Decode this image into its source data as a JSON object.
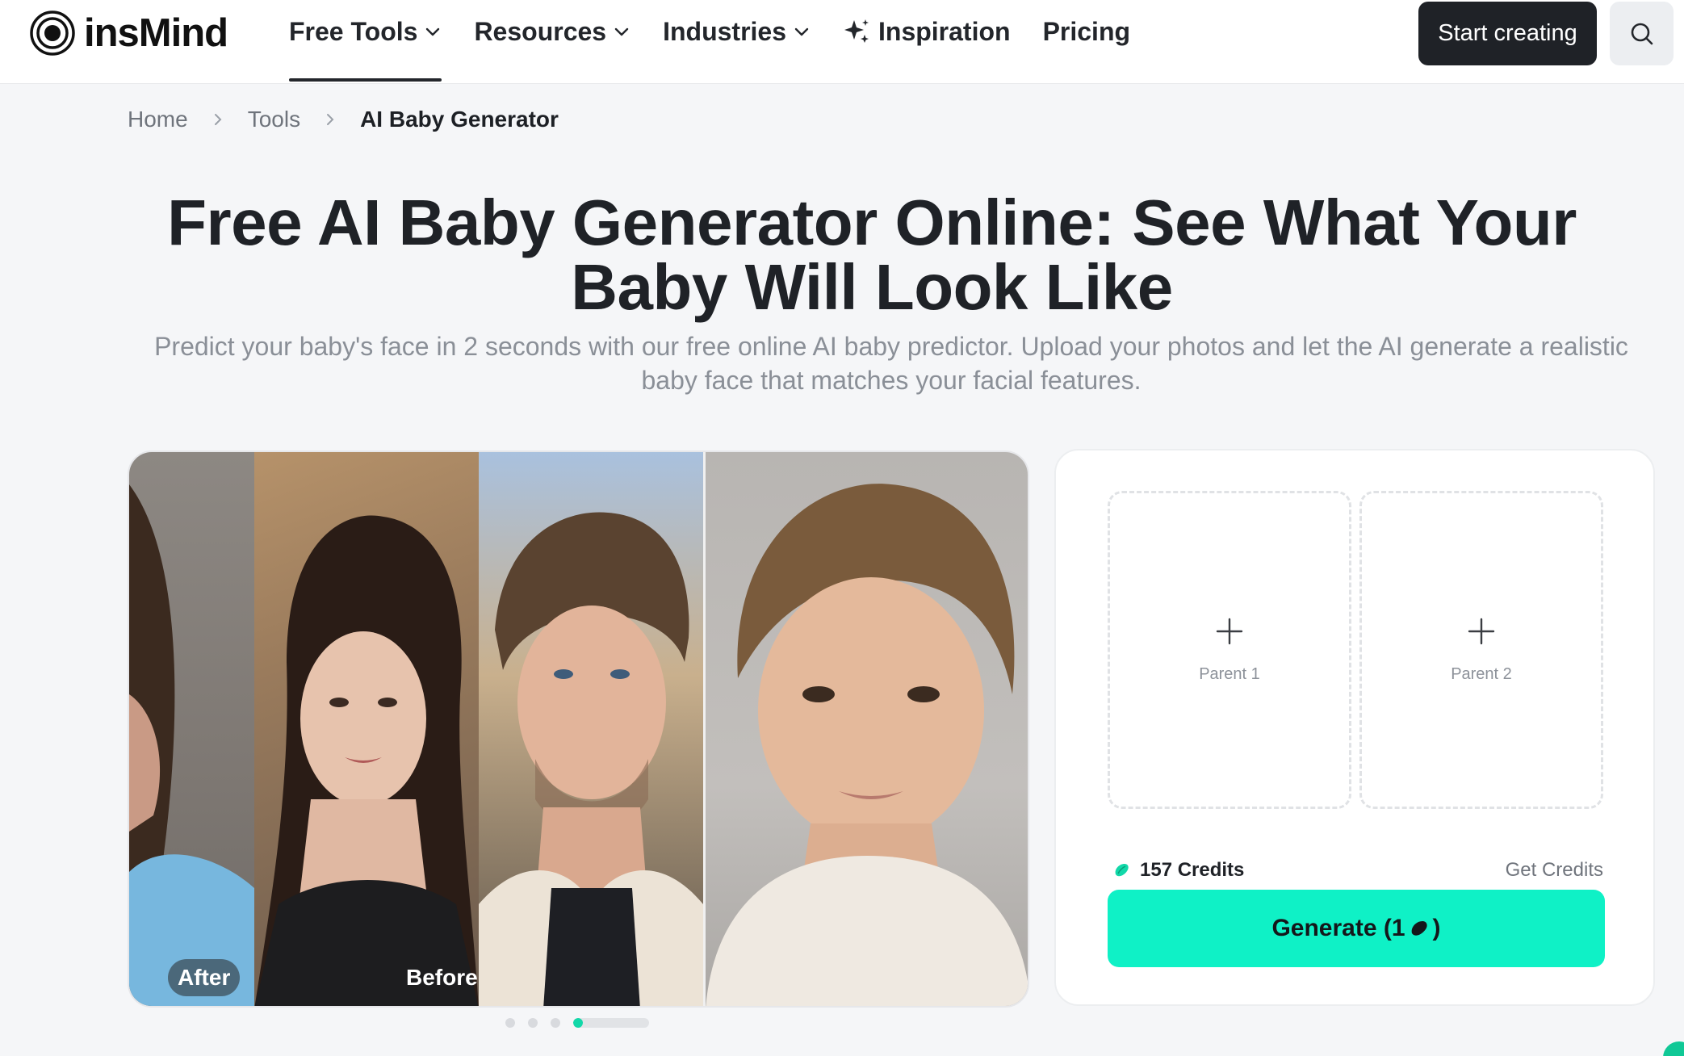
{
  "brand": {
    "name": "insMind"
  },
  "nav": {
    "items": [
      {
        "label": "Free Tools",
        "has_dropdown": true,
        "active": true
      },
      {
        "label": "Resources",
        "has_dropdown": true
      },
      {
        "label": "Industries",
        "has_dropdown": true
      },
      {
        "label": "Inspiration",
        "icon": "sparkle-icon"
      },
      {
        "label": "Pricing"
      }
    ],
    "cta": "Start creating",
    "search_icon": "search-icon"
  },
  "breadcrumb": {
    "items": [
      "Home",
      "Tools"
    ],
    "current": "AI Baby Generator"
  },
  "hero": {
    "title": "Free AI Baby Generator Online: See What Your Baby Will Look Like",
    "subtitle": "Predict your baby's face in 2 seconds with our free online AI baby predictor. Upload your photos and let the AI generate a realistic baby face that matches your facial features."
  },
  "showcase": {
    "badges": {
      "after": "After",
      "before": "Before"
    },
    "slide_count": 4,
    "active_slide": 4
  },
  "generator": {
    "slots": [
      {
        "label": "Parent 1"
      },
      {
        "label": "Parent 2"
      }
    ],
    "credits": "157 Credits",
    "get_credits": "Get Credits",
    "button_prefix": "Generate (1",
    "button_suffix": ")"
  },
  "colors": {
    "accent": "#0ff1c6",
    "dark": "#1f2227",
    "progress": "#12d8a9"
  }
}
